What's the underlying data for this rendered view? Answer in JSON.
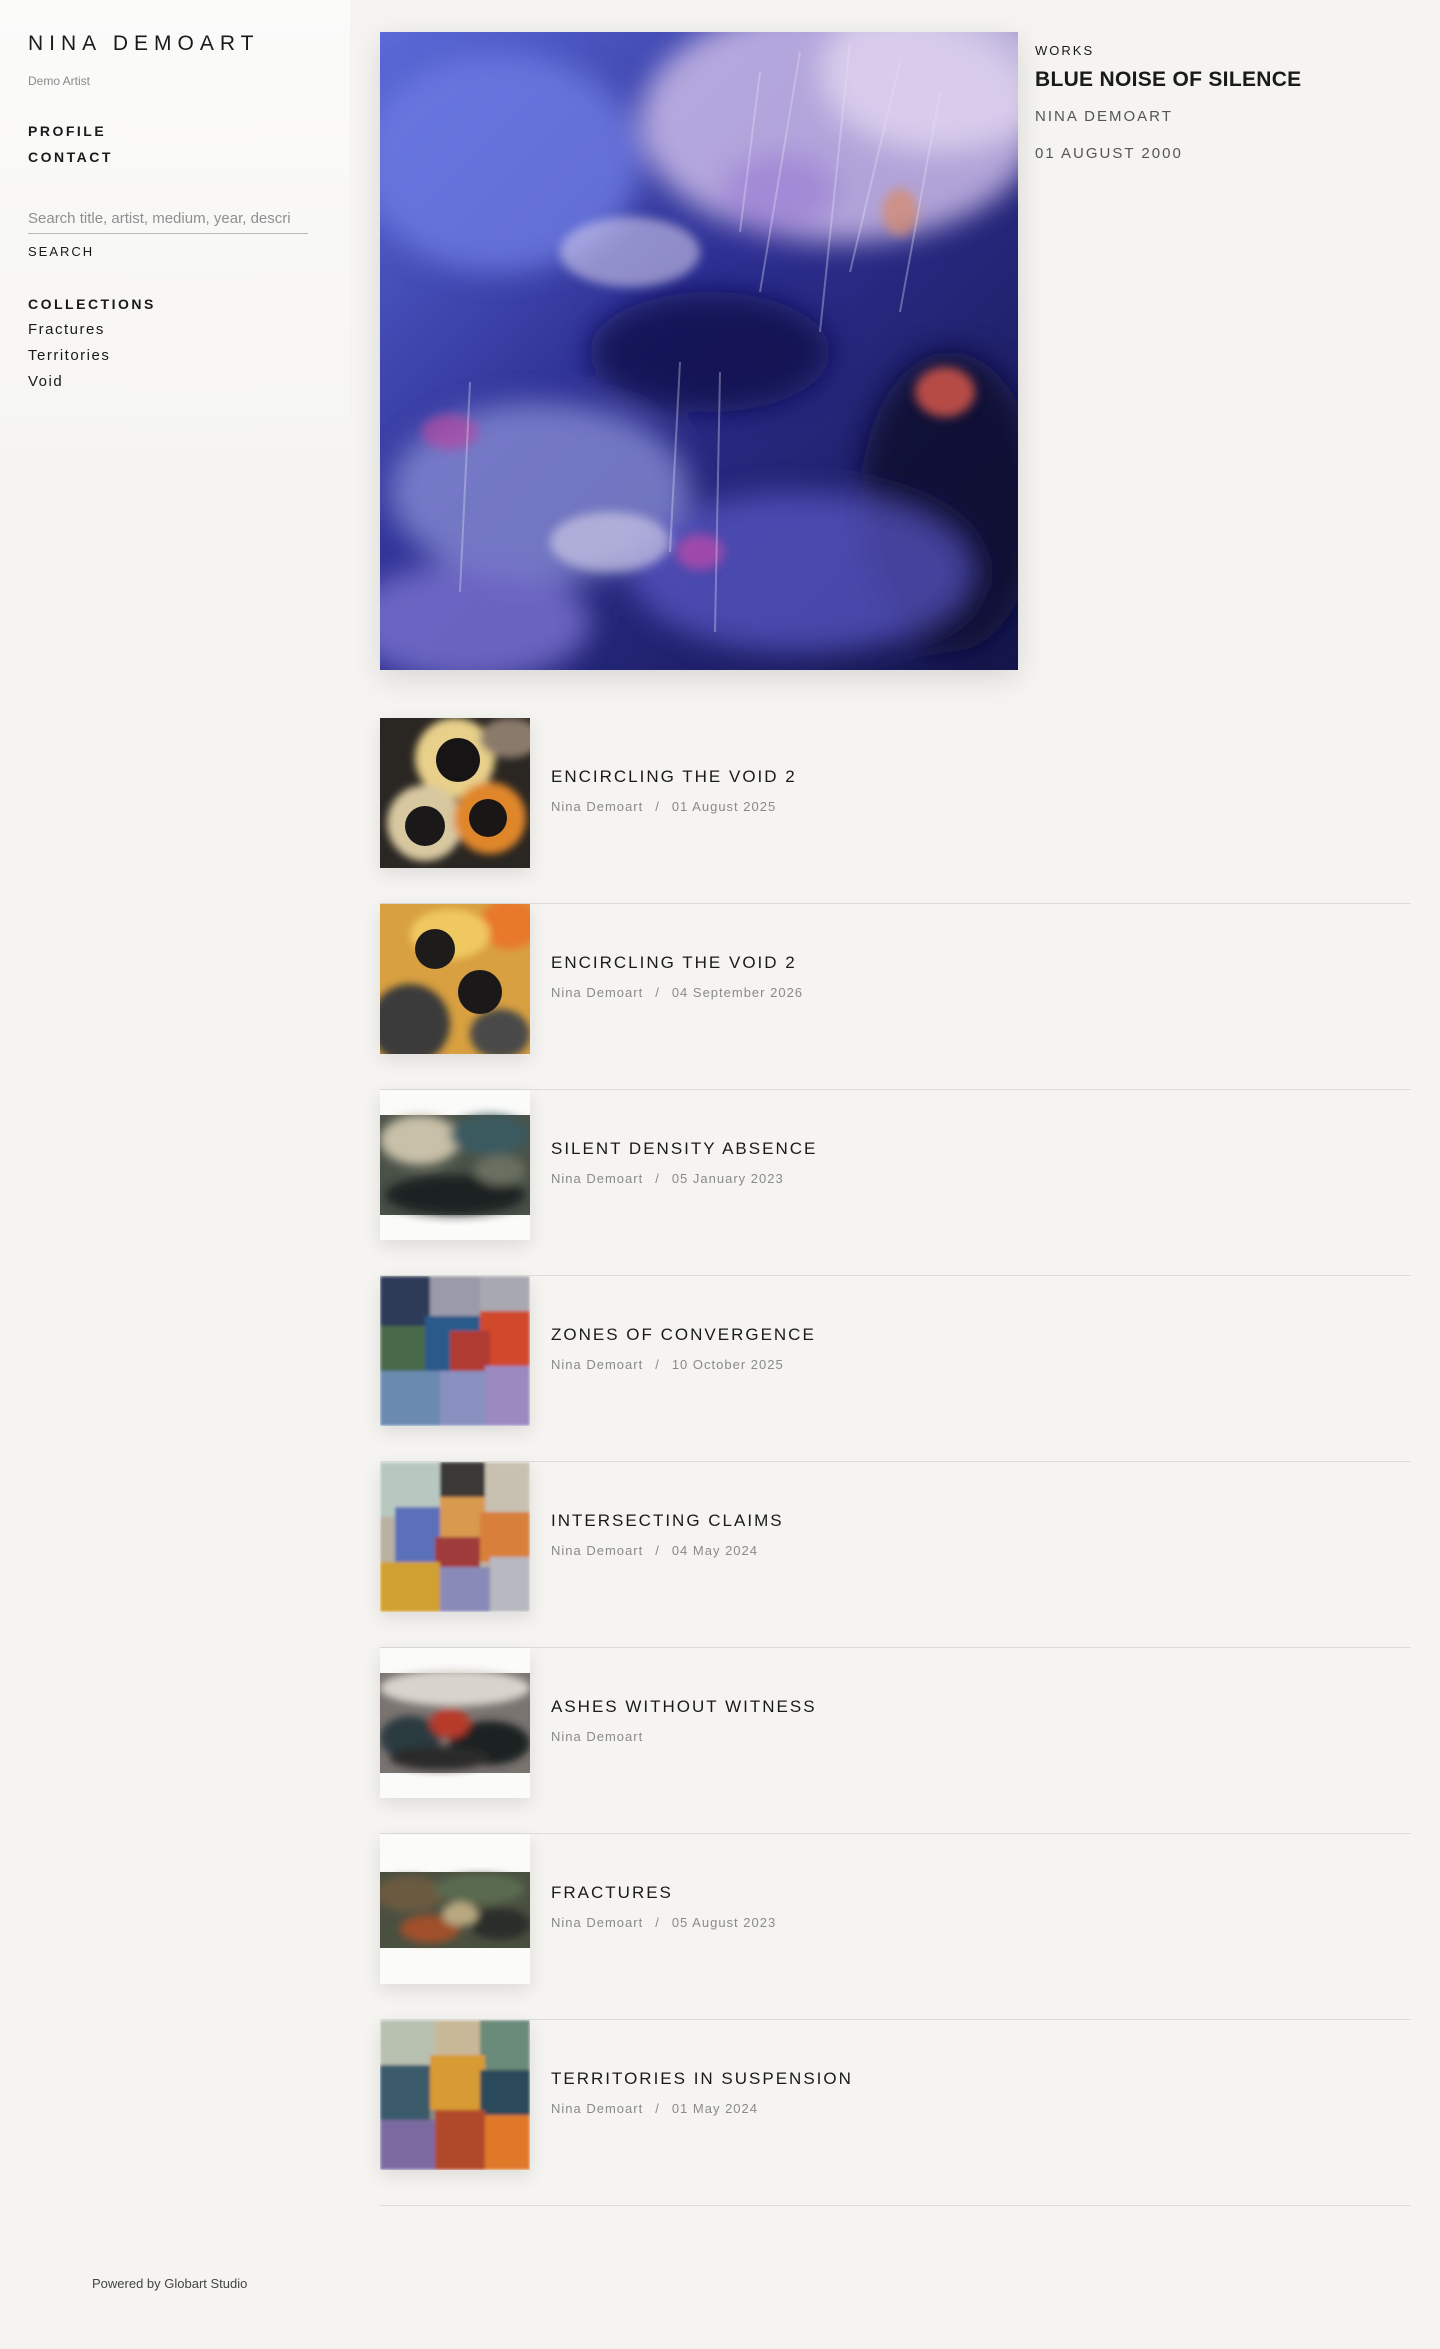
{
  "sidebar": {
    "site_title": "NINA DEMOART",
    "subtitle": "Demo Artist",
    "nav": [
      "PROFILE",
      "CONTACT"
    ],
    "search": {
      "placeholder": "Search title, artist, medium, year, descri",
      "button": "SEARCH"
    },
    "collections": {
      "title": "COLLECTIONS",
      "items": [
        "Fractures",
        "Territories",
        "Void"
      ]
    }
  },
  "featured": {
    "kicker": "WORKS",
    "title": "BLUE NOISE OF SILENCE",
    "artist": "NINA DEMOART",
    "date": "01 AUGUST 2000"
  },
  "works": [
    {
      "title": "ENCIRCLING THE VOID 2",
      "artist": "Nina Demoart",
      "separator": "/",
      "date": "01 August 2025",
      "thumb": "void-1"
    },
    {
      "title": "ENCIRCLING THE VOID 2",
      "artist": "Nina Demoart",
      "separator": "/",
      "date": "04 September 2026",
      "thumb": "void-2"
    },
    {
      "title": "SILENT DENSITY ABSENCE",
      "artist": "Nina Demoart",
      "separator": "/",
      "date": "05 January 2023",
      "thumb": "landscape-1"
    },
    {
      "title": "ZONES OF CONVERGENCE",
      "artist": "Nina Demoart",
      "separator": "/",
      "date": "10 October 2025",
      "thumb": "blocks-1"
    },
    {
      "title": "INTERSECTING CLAIMS",
      "artist": "Nina Demoart",
      "separator": "/",
      "date": "04 May 2024",
      "thumb": "blocks-2"
    },
    {
      "title": "ASHES WITHOUT WITNESS",
      "artist": "Nina Demoart",
      "separator": "",
      "date": "",
      "thumb": "landscape-2"
    },
    {
      "title": "FRACTURES",
      "artist": "Nina Demoart",
      "separator": "/",
      "date": "05 August 2023",
      "thumb": "landscape-3"
    },
    {
      "title": "TERRITORIES IN SUSPENSION",
      "artist": "Nina Demoart",
      "separator": "/",
      "date": "01 May 2024",
      "thumb": "blocks-3"
    }
  ],
  "footer": {
    "text": "Powered by Globart Studio"
  }
}
